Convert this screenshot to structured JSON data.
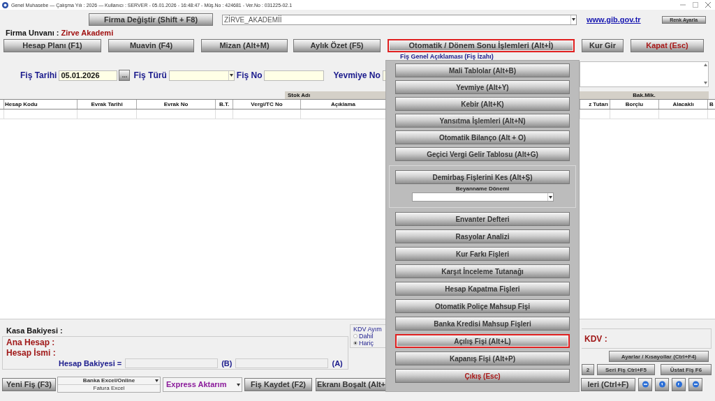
{
  "window": {
    "title": "Genel Muhasebe — Çalışma Yılı : 2026 — Kullanıcı : SERVER - 05.01.2026 - 16:48:47 - Müş.No : 424681 - Ver.No : 031225-02.1"
  },
  "company_bar": {
    "change_button": "Firma Değiştir (Shift + F8)",
    "company_select": {
      "value": "ZİRVE_AKADEMİİ"
    },
    "link": "www.gib.gov.tr",
    "color_button": "Renk Ayarla"
  },
  "company_title": {
    "label": "Firma Unvanı :",
    "value": "Zirve Akademi"
  },
  "toolbar": [
    {
      "label": "Hesap Planı (F1)",
      "kind": "normal",
      "highlighted": false
    },
    {
      "label": "Muavin (F4)",
      "kind": "normal",
      "highlighted": false
    },
    {
      "label": "Mizan (Alt+M)",
      "kind": "normal",
      "highlighted": false
    },
    {
      "label": "Aylık Özet (F5)",
      "kind": "normal",
      "highlighted": false
    },
    {
      "label": "Otomatik / Dönem Sonu İşlemleri (Alt+İ)",
      "kind": "normal",
      "highlighted": true
    },
    {
      "label": "Kur Gir",
      "kind": "normal",
      "highlighted": false
    },
    {
      "label": "Kapat (Esc)",
      "kind": "danger",
      "highlighted": false
    }
  ],
  "voucher_form": {
    "description_label": "Fiş Genel Açıklaması (Fiş İzahı)",
    "date_label": "Fiş Tarihi",
    "date_value": "05.01.2026",
    "picker_button": "...",
    "type_label": "Fiş Türü",
    "number_label": "Fiş No",
    "journal_label": "Yevmiye No"
  },
  "grid": {
    "group_headers": [
      "Stok Adı",
      "Bak.Mik."
    ],
    "columns": [
      "Hesap Kodu",
      "Evrak Tarihi",
      "Evrak No",
      "B.T.",
      "Vergi/TC No",
      "Açıklama",
      "z Tutarı",
      "Borçlu",
      "Alacaklı",
      "B"
    ]
  },
  "summary": {
    "cash_label": "Kasa Bakiyesi :",
    "main_account_label": "Ana Hesap :",
    "account_name_label": "Hesap İsmi :",
    "balance_label": "Hesap Bakiyesi =",
    "b_label": "(B)",
    "a_label": "(A)",
    "vat_group": {
      "title": "KDV Ayım",
      "options": [
        {
          "label": "Dahil",
          "selected": false
        },
        {
          "label": "Hariç",
          "selected": true
        }
      ]
    },
    "vat_label": "KDV :",
    "settings_button": "Ayarlar / Kısayollar (Ctrl+F4)",
    "small_buttons": [
      "2",
      "Seri Fiş Ctrl+F5",
      "Üstat Fiş F6"
    ]
  },
  "bottom_bar": {
    "new_button": "Yeni Fiş (F3)",
    "import_options": [
      "Banka Excel/Online",
      "Fatura Excel"
    ],
    "express_select": "Express Aktarım",
    "save_button": "Fiş Kaydet (F2)",
    "clear_button": "Ekranı Boşalt (Alt+",
    "list_button": "leri (Ctrl+F)"
  },
  "popup_menu": {
    "items": [
      {
        "kind": "button",
        "label": "Mali Tablolar (Alt+B)",
        "highlighted": false
      },
      {
        "kind": "button",
        "label": "Yevmiye (Alt+Y)",
        "highlighted": false
      },
      {
        "kind": "button",
        "label": "Kebir (Alt+K)",
        "highlighted": false
      },
      {
        "kind": "button",
        "label": "Yansıtma İşlemleri (Alt+N)",
        "highlighted": false
      },
      {
        "kind": "button",
        "label": "Otomatik Bilanço (Alt + O)",
        "highlighted": false
      },
      {
        "kind": "button",
        "label": "Geçici Vergi Gelir Tablosu (Alt+G)",
        "highlighted": false
      },
      {
        "kind": "group",
        "label": "Demirbaş Fişlerini Kes (Alt+Ş)",
        "field_label": "Beyanname Dönemi",
        "highlighted": false
      },
      {
        "kind": "button",
        "label": "Envanter Defteri",
        "highlighted": false
      },
      {
        "kind": "button",
        "label": "Rasyolar Analizi",
        "highlighted": false
      },
      {
        "kind": "button",
        "label": "Kur Farkı Fişleri",
        "highlighted": false
      },
      {
        "kind": "button",
        "label": "Karşıt İnceleme Tutanağı",
        "highlighted": false
      },
      {
        "kind": "button",
        "label": "Hesap Kapatma Fişleri",
        "highlighted": false
      },
      {
        "kind": "button",
        "label": "Otomatik Poliçe Mahsup Fişi",
        "highlighted": false
      },
      {
        "kind": "button",
        "label": "Banka Kredisi Mahsup Fişleri",
        "highlighted": false
      },
      {
        "kind": "button",
        "label": "Açılış Fişi (Alt+L)",
        "highlighted": true
      },
      {
        "kind": "button",
        "label": "Kapanış Fişi (Alt+P)",
        "highlighted": false
      },
      {
        "kind": "exit",
        "label": "Çıkış (Esc)",
        "highlighted": false
      }
    ]
  }
}
